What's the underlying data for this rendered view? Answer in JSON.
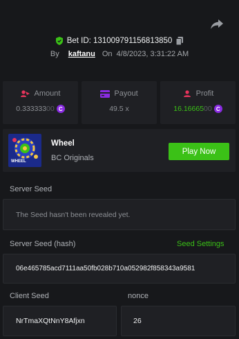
{
  "header": {
    "bet_id": "Bet ID: 131009791156813850",
    "by_label": "By",
    "username": "kaftanu",
    "on_label": "On",
    "timestamp": "4/8/2023, 3:31:22 AM"
  },
  "stats": {
    "amount": {
      "label": "Amount",
      "value_main": "0.333333",
      "value_dim": "00",
      "icon": "user-coins-icon",
      "icon_color": "#e8345c"
    },
    "payout": {
      "label": "Payout",
      "value": "49.5 x",
      "icon": "card-icon",
      "icon_color": "#8a2be2"
    },
    "profit": {
      "label": "Profit",
      "value_main": "16.16665",
      "value_dim": "00",
      "icon": "user-profit-icon",
      "icon_color": "#e8345c"
    },
    "coin_symbol": "C"
  },
  "game": {
    "name": "Wheel",
    "provider": "BC Originals",
    "thumb_label": "WHEEL",
    "play_label": "Play Now"
  },
  "server_seed": {
    "label": "Server Seed",
    "value": "The Seed hasn't been revealed yet."
  },
  "server_seed_hash": {
    "label": "Server Seed (hash)",
    "settings_link": "Seed Settings",
    "value": "06e465785acd7111aa50fb028b710a052982f858343a9581"
  },
  "client_seed": {
    "label": "Client Seed",
    "value": "NrTmaXQtNnY8Afjxn"
  },
  "nonce": {
    "label": "nonce",
    "value": "26"
  },
  "colors": {
    "background": "#17181b",
    "panel": "#1f2024",
    "accent_green": "#3bc117",
    "coin_purple": "#8a2be2"
  }
}
